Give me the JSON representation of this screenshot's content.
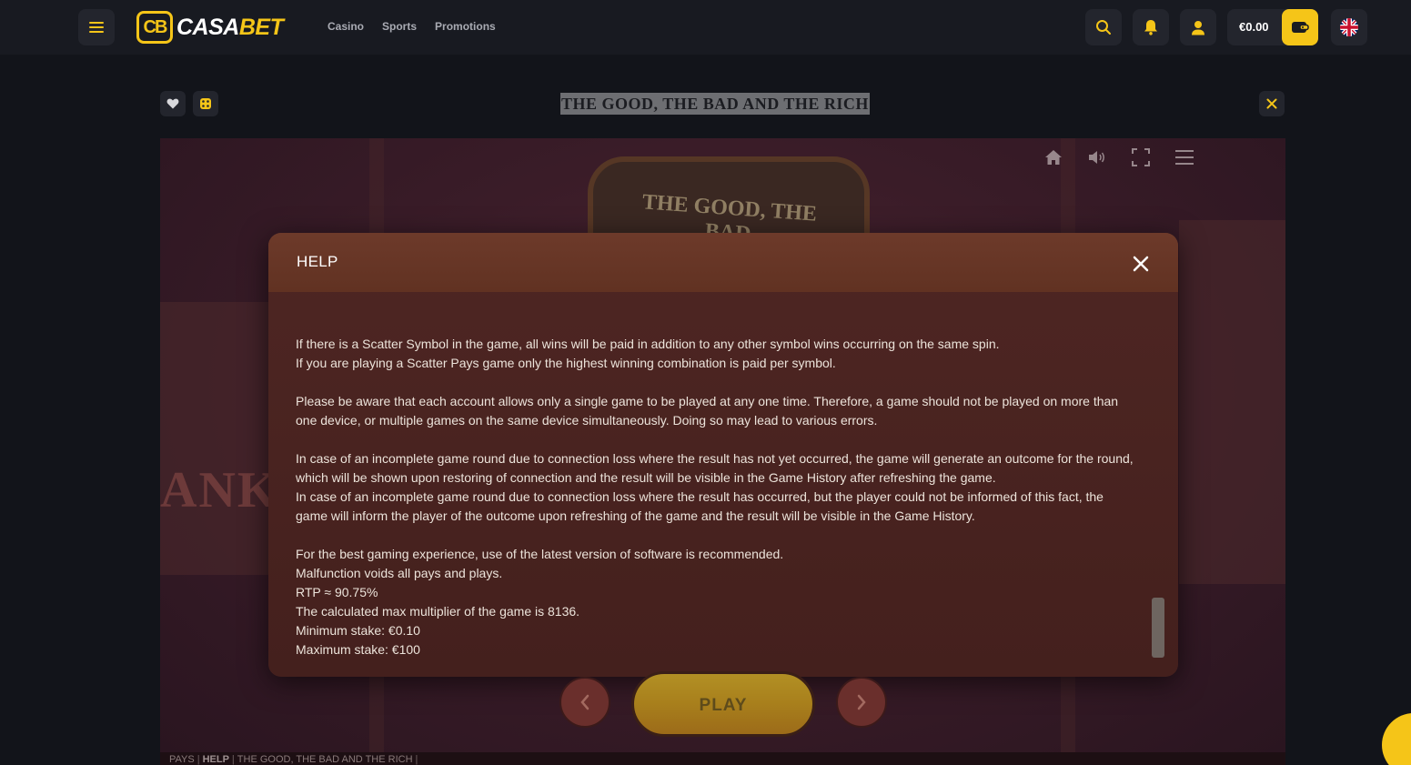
{
  "header": {
    "logo_mark": "CB",
    "logo_text_left": "CASA",
    "logo_text_right": "BET",
    "nav": [
      "Casino",
      "Sports",
      "Promotions"
    ],
    "balance": "€0.00",
    "accent_color": "#f5c518",
    "icons": [
      "hamburger-icon",
      "search-icon",
      "bell-icon",
      "user-icon",
      "wallet-icon",
      "uk-flag-icon"
    ]
  },
  "game": {
    "title": "THE GOOD, THE BAD AND THE RICH",
    "sign_text": "THE GOOD, THE BAD",
    "bank_text": "ANK",
    "controls": [
      "home-icon",
      "sound-icon",
      "fullscreen-icon",
      "menu-icon"
    ],
    "play_label": "PLAY"
  },
  "help": {
    "title": "HELP",
    "paragraphs": [
      "If there is a Scatter Symbol in the game, all wins will be paid in addition to any other symbol wins occurring on the same spin.\nIf you are playing a Scatter Pays game only the highest winning combination is paid per symbol.",
      "Please be aware that each account allows only a single game to be played at any one time. Therefore, a game should not be played on more than\none device, or multiple games on the same device simultaneously. Doing so may lead to various errors.",
      "In case of an incomplete game round due to connection loss where the result has not yet occurred, the game will generate an outcome for the round,\nwhich will be shown upon restoring of connection and the result will be visible in the Game History after refreshing the game.\nIn case of an incomplete game round due to connection loss where the result has occurred, but the player could not be informed of this fact, the\ngame will inform the player of the outcome upon refreshing of the game and the result will be visible in the Game History.",
      "For the best gaming experience, use of the latest version of software is recommended.\nMalfunction voids all pays and plays.\nRTP ≈ 90.75%\nThe calculated max multiplier of the game is 8136.\nMinimum stake: €0.10\nMaximum stake: €100"
    ]
  },
  "footer": {
    "items": [
      "PAYS",
      "HELP",
      "THE GOOD, THE BAD AND THE RICH"
    ]
  }
}
